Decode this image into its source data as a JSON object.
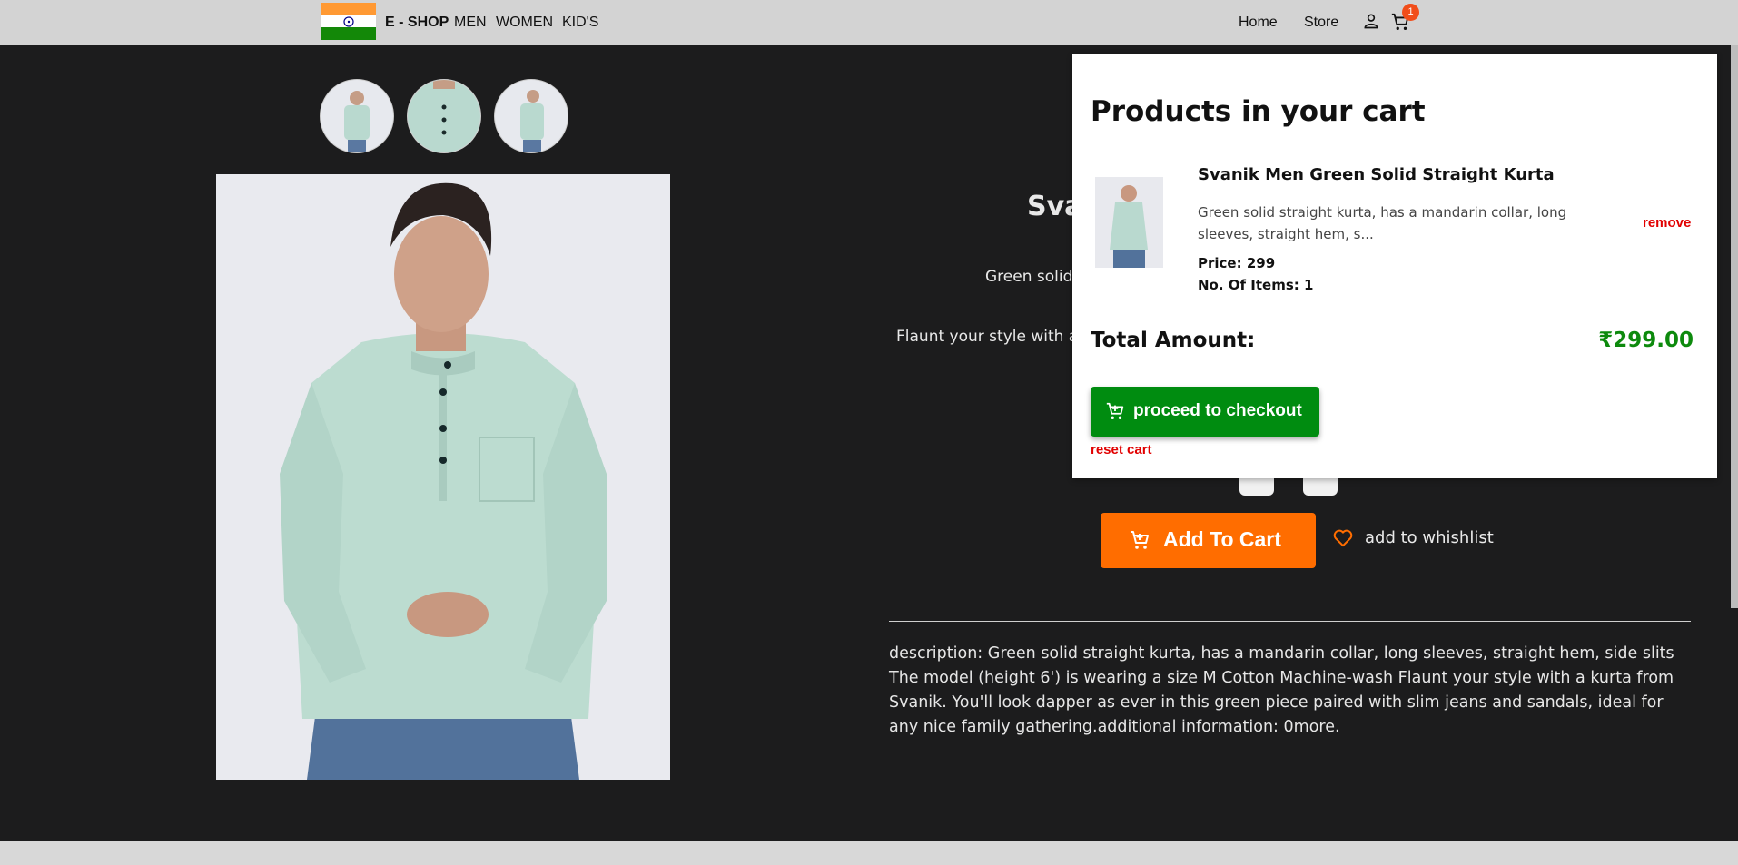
{
  "navbar": {
    "brand": "E - SHOP",
    "links": [
      "MEN",
      "WOMEN",
      "KID'S"
    ],
    "right_links": [
      "Home",
      "Store"
    ],
    "cart_count": "1"
  },
  "product": {
    "title_partial": "Sva",
    "subtitle_partial": "Green solid s",
    "tagline_partial": "Flaunt your style with a k",
    "add_to_cart_label": "Add To Cart",
    "wishlist_label": "add to whishlist",
    "description": "description: Green solid straight kurta, has a mandarin collar, long sleeves, straight hem, side slits The model (height 6') is wearing a size M Cotton Machine-wash Flaunt your style with a kurta from Svanik. You'll look dapper as ever in this green piece paired with slim jeans and sandals, ideal for any nice family gathering.additional information: 0more."
  },
  "cart": {
    "title": "Products in your cart",
    "item": {
      "name": "Svanik Men Green Solid Straight Kurta",
      "description": "Green solid straight kurta, has a mandarin collar, long sleeves, straight hem, s...",
      "price_text": "Price: 299",
      "items_text": "No. Of Items: 1",
      "remove_label": "remove"
    },
    "total_label": "Total Amount:",
    "total_value": "₹299.00",
    "checkout_label": "proceed to checkout",
    "reset_label": "reset cart"
  },
  "colors": {
    "accent_orange": "#ff6d00",
    "checkout_green": "#008c10",
    "danger_red": "#e10000",
    "badge": "#f14d1a"
  }
}
